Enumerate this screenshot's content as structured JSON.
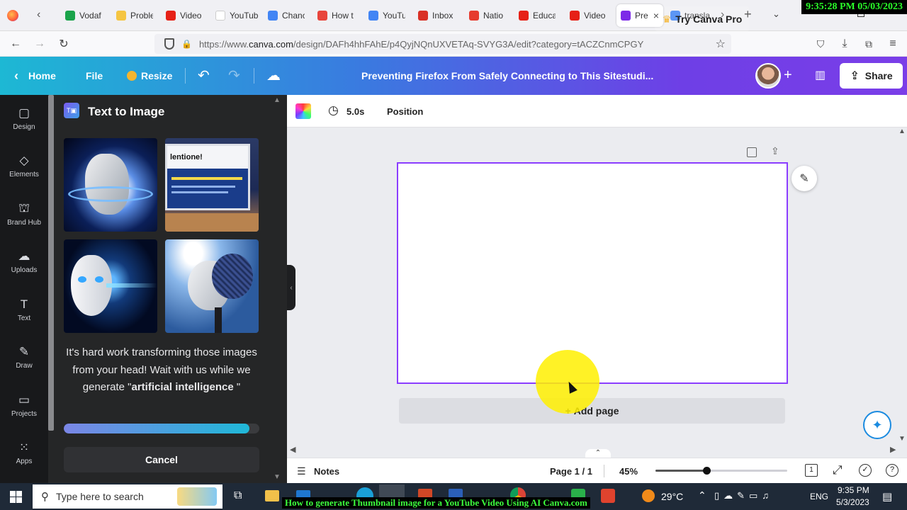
{
  "overlay": {
    "timestamp": "9:35:28 PM 05/03/2023",
    "caption": "How to generate Thumbnail image for a YouTube Video Using AI Canva.com"
  },
  "browser": {
    "tabs": [
      {
        "label": "Vodaf",
        "color": "#1aa34a"
      },
      {
        "label": "Proble",
        "color": "#f5c542"
      },
      {
        "label": "Video",
        "color": "#e62117"
      },
      {
        "label": "YouTube S",
        "color": "#ffffff"
      },
      {
        "label": "Chanc",
        "color": "#4285f4"
      },
      {
        "label": "How t",
        "color": "#e8453c"
      },
      {
        "label": "YouTu",
        "color": "#4285f4"
      },
      {
        "label": "Inbox",
        "color": "#d93025"
      },
      {
        "label": "Natio",
        "color": "#e63b2e"
      },
      {
        "label": "Educa",
        "color": "#e62117"
      },
      {
        "label": "Video",
        "color": "#e62117"
      },
      {
        "label": "Pre",
        "color": "#7d2ae8"
      },
      {
        "label": "transla",
        "color": "#4285f4"
      }
    ],
    "url_prefix": "https://www.",
    "url_domain": "canva.com",
    "url_rest": "/design/DAFh4hhFAhE/p4QyjNQnUXVETAq-SVYG3A/edit?category=tACZCnmCPGY"
  },
  "canva_header": {
    "home": "Home",
    "file": "File",
    "resize": "Resize",
    "doc_title": "Preventing Firefox From Safely Connecting to This Sitestudi...",
    "try_pro": "Try Canva Pro",
    "share": "Share"
  },
  "rail": [
    {
      "label": "Design",
      "icon": "design-icon"
    },
    {
      "label": "Elements",
      "icon": "elements-icon"
    },
    {
      "label": "Brand Hub",
      "icon": "brand-hub-icon"
    },
    {
      "label": "Uploads",
      "icon": "uploads-icon"
    },
    {
      "label": "Text",
      "icon": "text-icon"
    },
    {
      "label": "Draw",
      "icon": "draw-icon"
    },
    {
      "label": "Projects",
      "icon": "projects-icon"
    },
    {
      "label": "Apps",
      "icon": "apps-icon"
    }
  ],
  "panel": {
    "title": "Text to Image",
    "message_pre": "It's hard work transforming those images from your head! Wait with us while we generate \"",
    "message_bold": "artificial intelligence",
    "message_post": " \"",
    "progress": 0.95,
    "cancel": "Cancel"
  },
  "toolbar": {
    "duration": "5.0s",
    "position": "Position"
  },
  "editor": {
    "add_page": "Add page"
  },
  "footer": {
    "notes": "Notes",
    "page": "Page 1 / 1",
    "zoom": "45%",
    "zoom_level": 0.45,
    "pages_count": "1"
  },
  "taskbar": {
    "search_placeholder": "Type here to search",
    "weather": "29°C",
    "lang": "ENG",
    "time": "9:35 PM",
    "date": "5/3/2023"
  }
}
